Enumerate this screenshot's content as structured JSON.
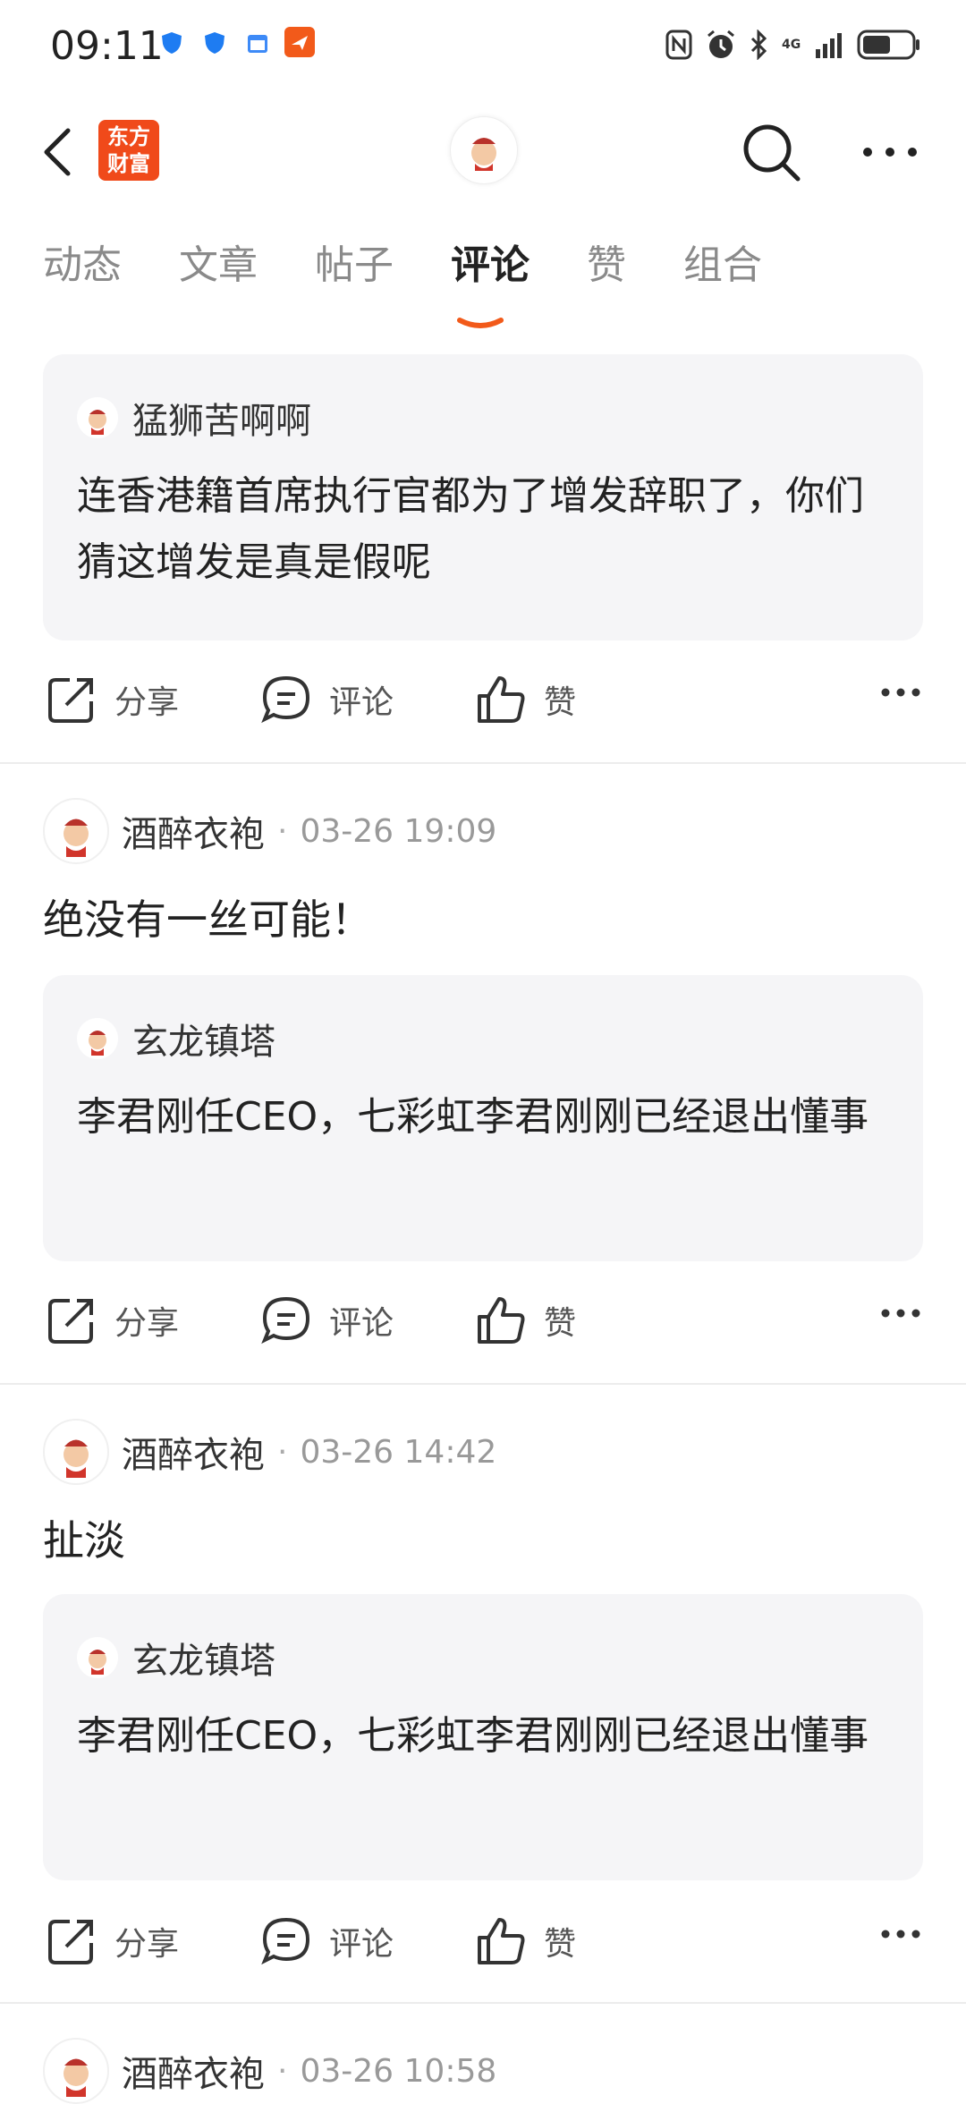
{
  "status_bar": {
    "time": "09:11",
    "network": "4G"
  },
  "nav": {
    "logo_text": "东方财富"
  },
  "tabs": [
    {
      "label": "动态"
    },
    {
      "label": "文章"
    },
    {
      "label": "帖子"
    },
    {
      "label": "评论"
    },
    {
      "label": "赞"
    },
    {
      "label": "组合"
    }
  ],
  "active_tab": "评论",
  "actions": {
    "share": "分享",
    "comment": "评论",
    "like": "赞"
  },
  "feed": [
    {
      "quote": {
        "name": "猛狮苦啊啊",
        "text": "连香港籍首席执行官都为了增发辞职了，你们猜这增发是真是假呢"
      }
    },
    {
      "author": "酒醉衣袍",
      "time": "03-26 19:09",
      "text": "绝没有一丝可能！",
      "quote": {
        "name": "玄龙镇塔",
        "text": "李君刚任CEO，七彩虹李君刚刚已经退出懂事"
      }
    },
    {
      "author": "酒醉衣袍",
      "time": "03-26 14:42",
      "text": "扯淡",
      "quote": {
        "name": "玄龙镇塔",
        "text": "李君刚任CEO，七彩虹李君刚刚已经退出懂事"
      }
    },
    {
      "author": "酒醉衣袍",
      "time": "03-26 10:58"
    }
  ],
  "colors": {
    "accent": "#f25a1a",
    "card_bg": "#f5f5f7"
  }
}
